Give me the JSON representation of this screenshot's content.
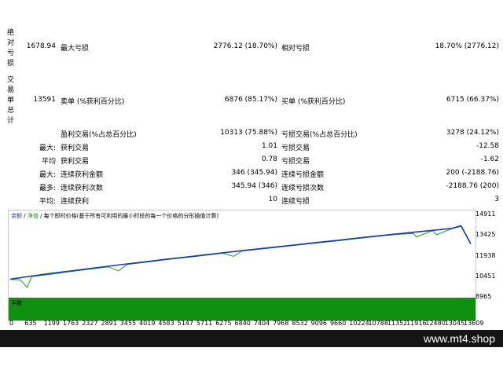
{
  "sections": {
    "absolute_drawdown": [
      "绝",
      "对",
      "亏",
      "损"
    ],
    "trade_summary": [
      "交",
      "易",
      "单",
      "总",
      "计"
    ]
  },
  "rows": [
    {
      "c1v": "1678.94",
      "c2l": "最大亏损",
      "c2v": "2776.12 (18.70%)",
      "c3l": "相对亏损",
      "c3v": "18.70% (2776.12)"
    },
    {
      "c1v": "13591",
      "c2l": "卖单 (%获利百分比)",
      "c2v": "6876 (85.17%)",
      "c3l": "买单 (%获利百分比)",
      "c3v": "6715 (66.37%)"
    },
    {
      "c1v": "",
      "c2l": "盈利交易(%占总百分比)",
      "c2v": "10313 (75.88%)",
      "c3l": "亏损交易(%占总百分比)",
      "c3v": "3278 (24.12%)"
    },
    {
      "c1l": "最大:",
      "c2l": "获利交易",
      "c2v": "1.01",
      "c3l": "亏损交易",
      "c3v": "-12.58"
    },
    {
      "c1l": "平均",
      "c2l": "获利交易",
      "c2v": "0.78",
      "c3l": "亏损交易",
      "c3v": "-1.62"
    },
    {
      "c1l": "最大:",
      "c2l": "连续获利金额",
      "c2v": "346 (345.94)",
      "c3l": "连续亏损金额",
      "c3v": "200 (-2188.76)"
    },
    {
      "c1l": "最多:",
      "c2l": "连续获利次数",
      "c2v": "345.94 (346)",
      "c3l": "连续亏损次数",
      "c3v": "-2188.76 (200)"
    },
    {
      "c1l": "平均:",
      "c2l": "连续获利",
      "c2v": "10",
      "c3l": "连续亏损",
      "c3v": "3"
    }
  ],
  "chart_legend": {
    "balance": "余额",
    "sep": "/",
    "equity": "净值",
    "desc": "/ 每个即时价格(基于所有可利用的最小时段的每一个价格的分形插值计算)"
  },
  "volume_label": "手数",
  "footer_brand": "www.mt4.shop",
  "colors": {
    "balance": "#1f3aa8",
    "equity": "#1ea01e",
    "volume": "#109010"
  },
  "chart_data": {
    "type": "line",
    "x_ticks": [
      "0",
      "635",
      "1199",
      "1763",
      "2327",
      "2891",
      "3455",
      "4019",
      "4583",
      "5147",
      "5711",
      "6275",
      "6840",
      "7404",
      "7968",
      "8532",
      "9096",
      "9660",
      "10224",
      "10788",
      "11352",
      "11916",
      "12480",
      "13045",
      "13609"
    ],
    "y_ticks": [
      "14911",
      "13425",
      "11938",
      "10451",
      "8965"
    ],
    "ylim": [
      8965,
      14911
    ],
    "xlim": [
      0,
      13609
    ],
    "series": [
      {
        "name": "余额",
        "points": [
          [
            0,
            10300
          ],
          [
            635,
            10520
          ],
          [
            1199,
            10720
          ],
          [
            1763,
            10880
          ],
          [
            2327,
            11060
          ],
          [
            2891,
            11230
          ],
          [
            3455,
            11400
          ],
          [
            4019,
            11560
          ],
          [
            4583,
            11730
          ],
          [
            5147,
            11880
          ],
          [
            5711,
            12040
          ],
          [
            6275,
            12200
          ],
          [
            6840,
            12350
          ],
          [
            7404,
            12500
          ],
          [
            7968,
            12650
          ],
          [
            8532,
            12800
          ],
          [
            9096,
            12950
          ],
          [
            9660,
            13100
          ],
          [
            10224,
            13250
          ],
          [
            10788,
            13400
          ],
          [
            11352,
            13540
          ],
          [
            11916,
            13680
          ],
          [
            12480,
            13820
          ],
          [
            13045,
            13960
          ],
          [
            13320,
            14150
          ],
          [
            13609,
            12850
          ]
        ]
      },
      {
        "name": "净值",
        "points": [
          [
            0,
            10280
          ],
          [
            300,
            10250
          ],
          [
            500,
            9700
          ],
          [
            635,
            10480
          ],
          [
            1199,
            10650
          ],
          [
            1763,
            10840
          ],
          [
            2327,
            11010
          ],
          [
            2891,
            11190
          ],
          [
            3200,
            10900
          ],
          [
            3455,
            11360
          ],
          [
            4019,
            11520
          ],
          [
            4583,
            11700
          ],
          [
            5147,
            11850
          ],
          [
            5711,
            12000
          ],
          [
            6275,
            12170
          ],
          [
            6600,
            11950
          ],
          [
            6840,
            12320
          ],
          [
            7404,
            12470
          ],
          [
            7968,
            12620
          ],
          [
            8532,
            12770
          ],
          [
            9096,
            12920
          ],
          [
            9660,
            13060
          ],
          [
            10224,
            13220
          ],
          [
            10788,
            13370
          ],
          [
            11352,
            13510
          ],
          [
            11916,
            13600
          ],
          [
            12000,
            13350
          ],
          [
            12480,
            13790
          ],
          [
            12600,
            13500
          ],
          [
            13045,
            13930
          ],
          [
            13320,
            14100
          ],
          [
            13609,
            12820
          ]
        ]
      }
    ]
  }
}
